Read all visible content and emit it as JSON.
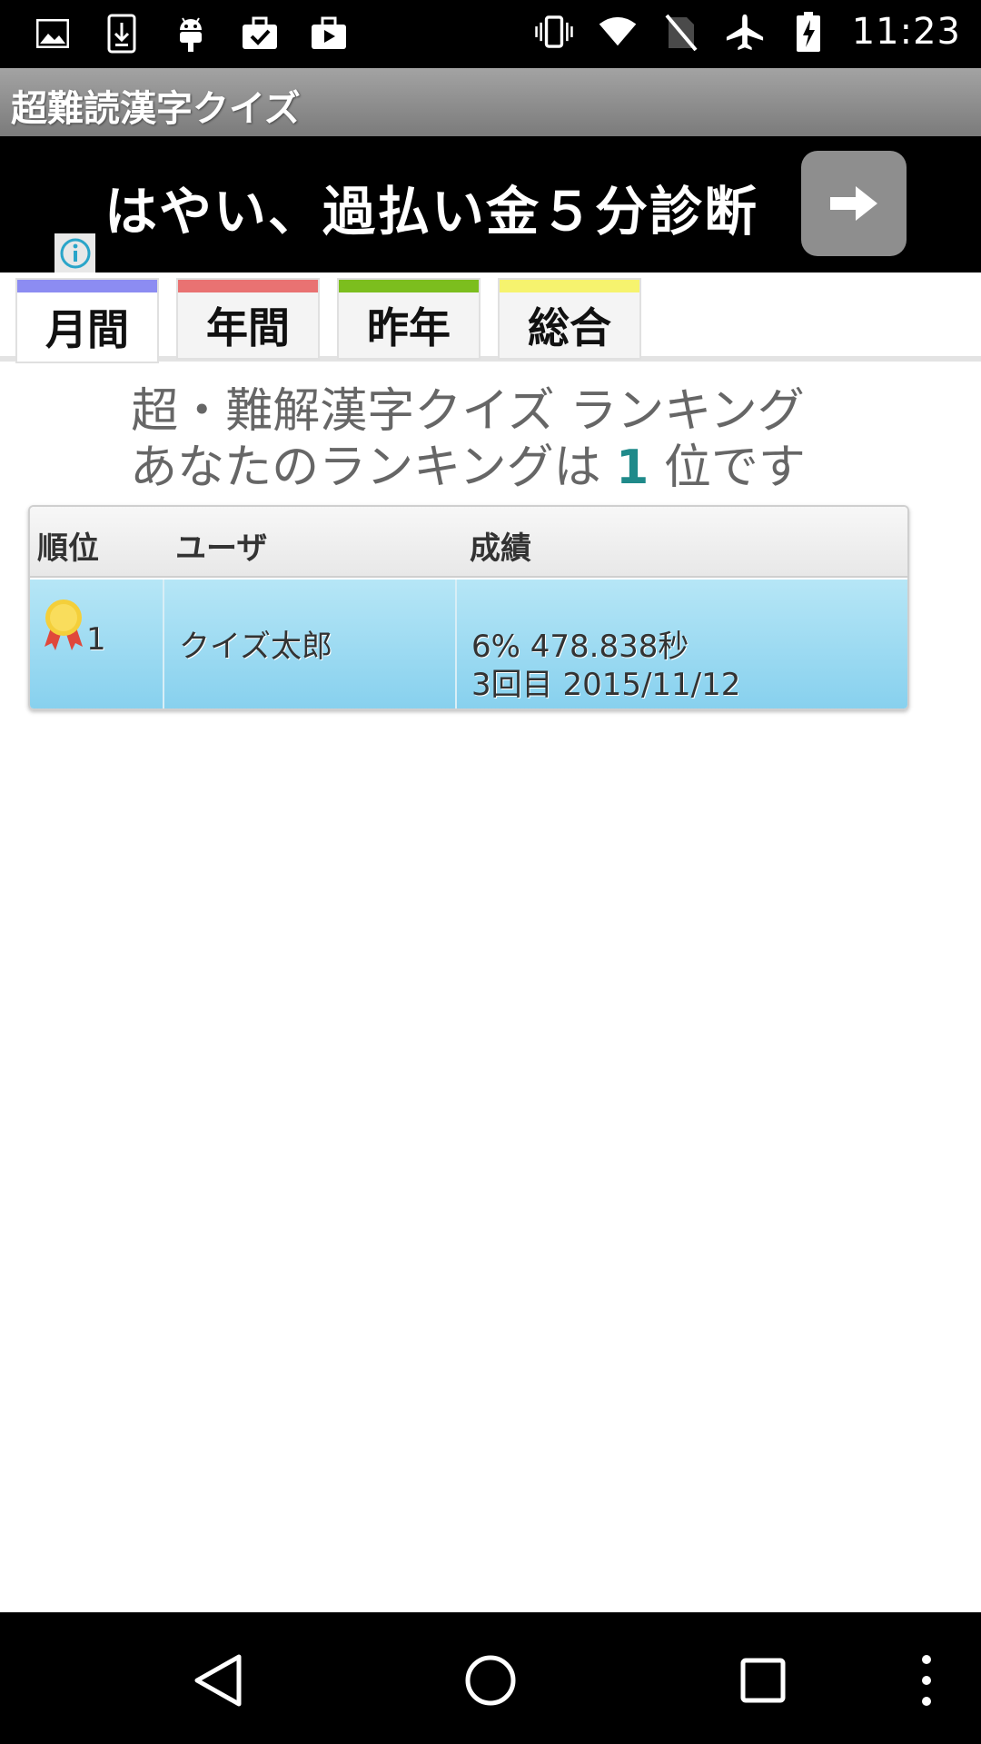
{
  "status_bar": {
    "time": "11:23",
    "left_icons": [
      "image-icon",
      "download-icon",
      "android-icon",
      "briefcase-check-icon",
      "play-store-icon"
    ],
    "right_icons": [
      "vibrate-icon",
      "wifi-icon",
      "no-sim-icon",
      "airplane-icon",
      "battery-charging-icon"
    ]
  },
  "app_bar": {
    "title": "超難読漢字クイズ"
  },
  "ad": {
    "text": "はやい、過払い金５分診断"
  },
  "tabs": [
    {
      "label": "月間",
      "color": "#8c8cf2",
      "active": true
    },
    {
      "label": "年間",
      "color": "#e97272",
      "active": false
    },
    {
      "label": "昨年",
      "color": "#7cbe1e",
      "active": false
    },
    {
      "label": "総合",
      "color": "#f6f36e",
      "active": false
    }
  ],
  "heading": {
    "line1": "超・難解漢字クイズ ランキング",
    "line2_prefix": "あなたのランキングは",
    "rank": "1",
    "line2_suffix": "位です"
  },
  "table": {
    "columns": [
      "順位",
      "ユーザ",
      "成績"
    ],
    "rows": [
      {
        "rank": "1",
        "user": "クイズ太郎",
        "score_line1": "6% 478.838秒",
        "score_line2": "3回目 2015/11/12"
      }
    ]
  },
  "nav_bar": {
    "buttons": [
      "back-icon",
      "home-icon",
      "recents-icon",
      "overflow-menu-icon"
    ]
  }
}
